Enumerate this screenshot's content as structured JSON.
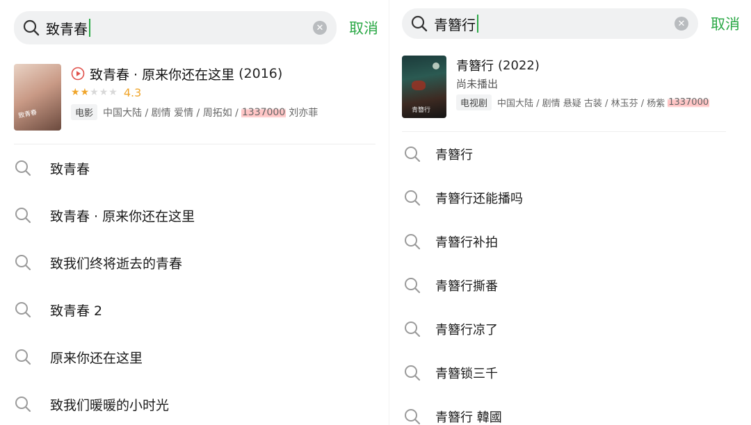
{
  "left": {
    "search": {
      "query": "致青春",
      "cancel_label": "取消"
    },
    "result": {
      "title": "致青春 · 原来你还在这里",
      "year": "(2016)",
      "rating": "4.3",
      "stars_filled": 2,
      "stars_total": 5,
      "tag": "电影",
      "meta": "中国大陆 / 剧情 爱情 / 周拓如 /",
      "highlight": "1337000",
      "meta_tail": "刘亦菲",
      "poster_text": "致青春"
    },
    "suggestions": [
      {
        "label": "致青春"
      },
      {
        "label": "致青春 · 原来你还在这里"
      },
      {
        "label": "致我们终将逝去的青春"
      },
      {
        "label": "致青春 2"
      },
      {
        "label": "原来你还在这里"
      },
      {
        "label": "致我们暖暖的小时光"
      }
    ]
  },
  "right": {
    "search": {
      "query": "青簪行",
      "cancel_label": "取消"
    },
    "result": {
      "title": "青簪行",
      "year": "(2022)",
      "status": "尚未播出",
      "tag": "电视剧",
      "meta": "中国大陆 / 剧情 悬疑 古装 / 林玉芬 / 杨紫",
      "highlight": "1337000",
      "poster_text": "青簪行"
    },
    "suggestions": [
      {
        "label": "青簪行"
      },
      {
        "label": "青簪行还能播吗"
      },
      {
        "label": "青簪行补拍"
      },
      {
        "label": "青簪行撕番"
      },
      {
        "label": "青簪行凉了"
      },
      {
        "label": "青簪锁三千"
      },
      {
        "label": "青簪行 韓國"
      }
    ]
  },
  "colors": {
    "accent": "#2aa845",
    "star": "#f0a52a",
    "highlight": "#ff9a9a",
    "play": "#e0504a"
  },
  "icons": [
    "search-icon",
    "clear-icon",
    "play-icon",
    "star-icon"
  ]
}
